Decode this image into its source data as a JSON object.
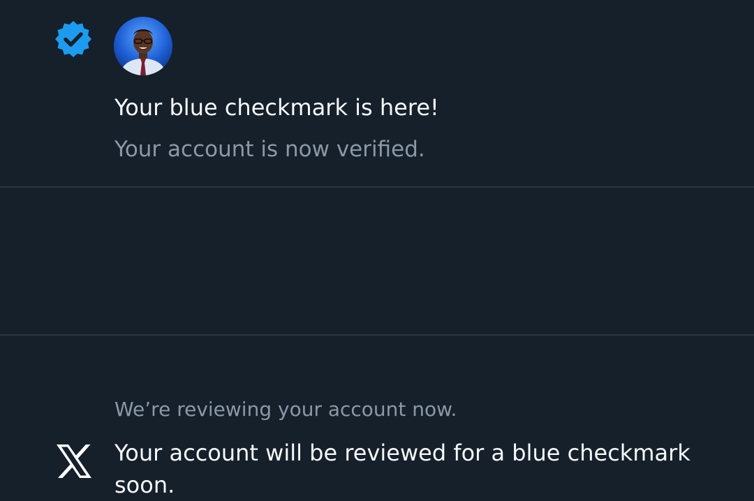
{
  "notifications": [
    {
      "icon": "verified-badge-icon",
      "icon_color": "#1d9bf0",
      "has_avatar": true,
      "title": "Your blue checkmark is here!",
      "subtitle": "Your account is now verified."
    },
    {
      "icon": "x-logo-icon",
      "icon_color": "#ffffff",
      "caption": "We’re reviewing your account now.",
      "body": "Your account will be reviewed for a blue checkmark soon."
    }
  ],
  "colors": {
    "background": "#15202b",
    "divider": "#2b3640",
    "primary_text": "#f7f9f9",
    "secondary_text": "#8b98a5",
    "accent": "#1d9bf0"
  }
}
